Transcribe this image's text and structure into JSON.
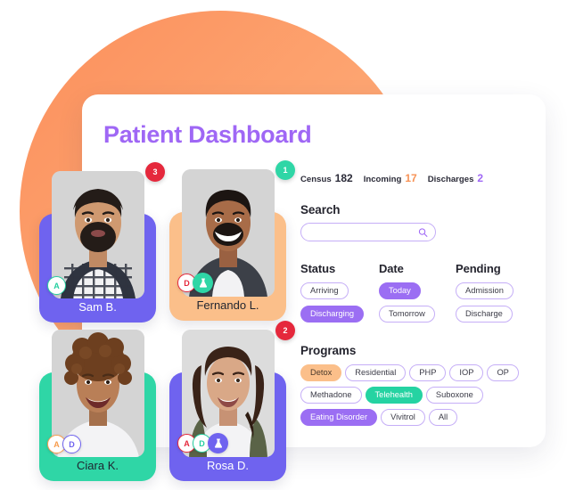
{
  "header": {
    "title": "Patient Dashboard"
  },
  "stats": [
    {
      "label": "Census",
      "value": "182",
      "color_class": ""
    },
    {
      "label": "Incoming",
      "value": "17",
      "color_class": "orange"
    },
    {
      "label": "Discharges",
      "value": "2",
      "color_class": "purple"
    }
  ],
  "search": {
    "title": "Search",
    "value": "",
    "placeholder": "",
    "icon": "search-icon"
  },
  "filters": {
    "status": {
      "title": "Status",
      "chips": [
        {
          "label": "Arriving",
          "selected": false,
          "style": ""
        },
        {
          "label": "Discharging",
          "selected": true,
          "style": "sel-purple"
        }
      ]
    },
    "date": {
      "title": "Date",
      "chips": [
        {
          "label": "Today",
          "selected": true,
          "style": "sel-purple"
        },
        {
          "label": "Tomorrow",
          "selected": false,
          "style": ""
        }
      ]
    },
    "pending": {
      "title": "Pending",
      "chips": [
        {
          "label": "Admission",
          "selected": false,
          "style": ""
        },
        {
          "label": "Discharge",
          "selected": false,
          "style": ""
        }
      ]
    }
  },
  "programs": {
    "title": "Programs",
    "chips": [
      {
        "label": "Detox",
        "selected": true,
        "style": "sel-orange"
      },
      {
        "label": "Residential",
        "selected": false,
        "style": ""
      },
      {
        "label": "PHP",
        "selected": false,
        "style": ""
      },
      {
        "label": "IOP",
        "selected": false,
        "style": ""
      },
      {
        "label": "OP",
        "selected": false,
        "style": ""
      },
      {
        "label": "Methadone",
        "selected": false,
        "style": ""
      },
      {
        "label": "Telehealth",
        "selected": true,
        "style": "sel-teal"
      },
      {
        "label": "Suboxone",
        "selected": false,
        "style": ""
      },
      {
        "label": "Eating Disorder",
        "selected": true,
        "style": "sel-purple"
      },
      {
        "label": "Vivitrol",
        "selected": false,
        "style": ""
      },
      {
        "label": "All",
        "selected": false,
        "style": ""
      }
    ]
  },
  "patients": [
    {
      "name": "Sam B.",
      "count": "3",
      "count_color": "red",
      "card_color": "#6f63ef",
      "badges": [
        {
          "type": "letter",
          "text": "A",
          "color": "teal"
        }
      ]
    },
    {
      "name": "Fernando L.",
      "count": "1",
      "count_color": "teal",
      "card_color": "#fbbf8a",
      "badges": [
        {
          "type": "letter",
          "text": "D",
          "color": "red"
        },
        {
          "type": "flask",
          "text": "",
          "color": "teal"
        }
      ]
    },
    {
      "name": "Ciara K.",
      "count": "",
      "count_color": "",
      "card_color": "#2fd6a6",
      "badges": [
        {
          "type": "letter",
          "text": "A",
          "color": "orange"
        },
        {
          "type": "letter",
          "text": "D",
          "color": "purple"
        }
      ]
    },
    {
      "name": "Rosa D.",
      "count": "2",
      "count_color": "red",
      "card_color": "#6f63ef",
      "badges": [
        {
          "type": "letter",
          "text": "A",
          "color": "red"
        },
        {
          "type": "letter",
          "text": "D",
          "color": "teal"
        },
        {
          "type": "flask",
          "text": "",
          "color": "purple"
        }
      ]
    }
  ],
  "colors": {
    "brand_purple": "#9f67f5",
    "accent_orange": "#f79256",
    "accent_teal": "#2fd6a6",
    "accent_red": "#e5283c",
    "blob_orange": "#fb8f5c",
    "chip_border": "#c5aef7"
  }
}
